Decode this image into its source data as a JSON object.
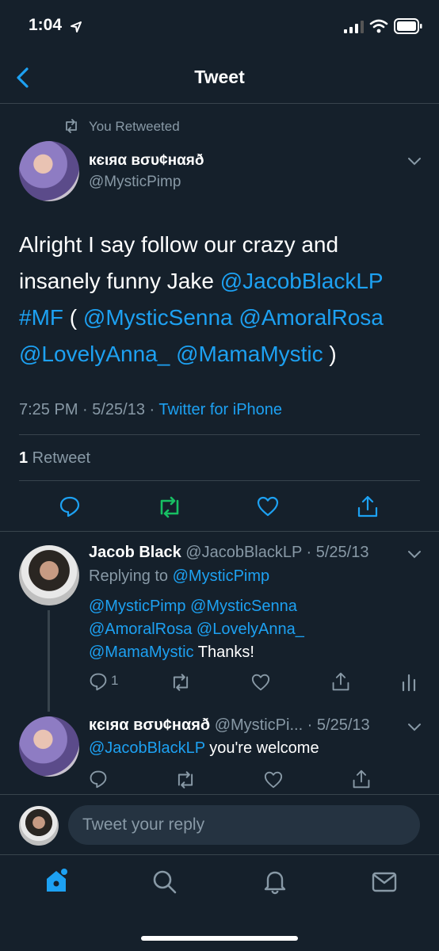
{
  "status_bar": {
    "time": "1:04",
    "location_arrow": "location-arrow-icon"
  },
  "nav": {
    "title": "Tweet",
    "back": "chevron-left-icon"
  },
  "main_tweet": {
    "retweet_note": "You Retweeted",
    "display_name": "кєιяα вσυ¢нαяð",
    "handle": "@MysticPimp",
    "text_lines": [
      [
        {
          "t": "Alright I say follow our crazy and",
          "c": "white"
        }
      ],
      [
        {
          "t": "insanely funny Jake ",
          "c": "white"
        },
        {
          "t": "@JacobBlackLP",
          "c": "blue"
        }
      ],
      [
        {
          "t": "#MF",
          "c": "blue"
        },
        {
          "t": " ( ",
          "c": "white"
        },
        {
          "t": "@MysticSenna",
          "c": "blue"
        },
        {
          "t": " ",
          "c": "white"
        },
        {
          "t": "@AmoralRosa",
          "c": "blue"
        }
      ],
      [
        {
          "t": "@LovelyAnna_",
          "c": "blue"
        },
        {
          "t": " ",
          "c": "white"
        },
        {
          "t": "@MamaMystic",
          "c": "blue"
        },
        {
          "t": " )",
          "c": "white"
        }
      ]
    ],
    "meta_time": "7:25 PM · 5/25/13 · ",
    "meta_source": "Twitter for iPhone",
    "retweet_count": "1",
    "retweet_label": " Retweet"
  },
  "reply1": {
    "display_name": "Jacob Black",
    "handle_date": "@JacobBlackLP · 5/25/13",
    "replying_prefix": "Replying to ",
    "replying_handle": "@MysticPimp",
    "body_lines": [
      [
        {
          "t": "@MysticPimp",
          "c": "blue"
        },
        {
          "t": " ",
          "c": "white"
        },
        {
          "t": "@MysticSenna",
          "c": "blue"
        }
      ],
      [
        {
          "t": "@AmoralRosa",
          "c": "blue"
        },
        {
          "t": " ",
          "c": "white"
        },
        {
          "t": "@LovelyAnna_",
          "c": "blue"
        }
      ],
      [
        {
          "t": "@MamaMystic",
          "c": "blue"
        },
        {
          "t": " Thanks!",
          "c": "white"
        }
      ]
    ],
    "reply_count": "1"
  },
  "reply2": {
    "display_name": "кєιяα вσυ¢нαяð",
    "handle_date": "@MysticPi... · 5/25/13",
    "body_handle": "@JacobBlackLP",
    "body_text": " you're welcome"
  },
  "compose": {
    "placeholder": "Tweet your reply"
  },
  "tabbar": [
    "home-icon",
    "search-icon",
    "bell-icon",
    "mail-icon"
  ],
  "colors": {
    "background": "#15202b",
    "accent": "#1da1f2",
    "retweet_green": "#17bf63",
    "muted": "#8899a6",
    "divider": "#38444d"
  }
}
